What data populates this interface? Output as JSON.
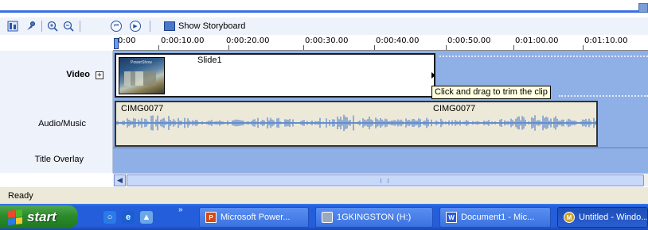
{
  "toolbar": {
    "storyboard_label": "Show Storyboard"
  },
  "ruler": {
    "ticks": [
      "0:00",
      "0:00:10.00",
      "0:00:20.00",
      "0:00:30.00",
      "0:00:40.00",
      "0:00:50.00",
      "0:01:00.00",
      "0:01:10.00"
    ]
  },
  "tracks": {
    "video_label": "Video",
    "audio_label": "Audio/Music",
    "title_label": "Title Overlay",
    "video_clip_name": "Slide1",
    "thumbnail_caption": "PowerShow",
    "audio_clip_name_1": "CIMG0077",
    "audio_clip_name_2": "CIMG0077"
  },
  "tooltip": "Click and drag to trim the clip",
  "status": "Ready",
  "taskbar": {
    "start_label": "start",
    "buttons": [
      {
        "label": "Microsoft Power...",
        "icon": "powerpoint-icon"
      },
      {
        "label": "1GKINGSTON (H:)",
        "icon": "drive-icon"
      },
      {
        "label": "Document1 - Mic...",
        "icon": "word-icon"
      },
      {
        "label": "Untitled - Windo...",
        "icon": "moviemaker-icon"
      }
    ]
  }
}
